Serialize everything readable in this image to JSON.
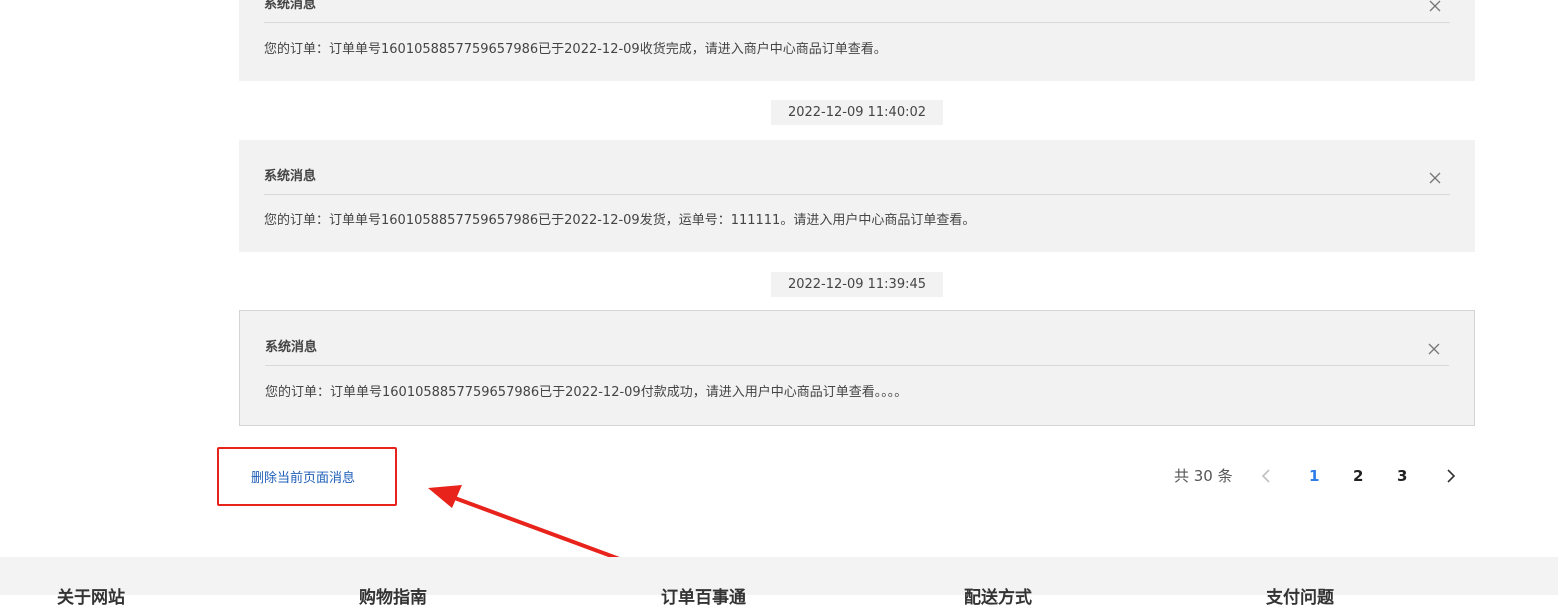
{
  "messages": [
    {
      "title": "系统消息",
      "body": "您的订单：订单单号1601058857759657986已于2022-12-09收货完成，请进入商户中心商品订单查看。"
    },
    {
      "time": "2022-12-09 11:40:02",
      "title": "系统消息",
      "body": "您的订单：订单单号1601058857759657986已于2022-12-09发货，运单号：111111。请进入用户中心商品订单查看。"
    },
    {
      "time": "2022-12-09 11:39:45",
      "title": "系统消息",
      "body": "您的订单：订单单号1601058857759657986已于2022-12-09付款成功，请进入用户中心商品订单查看。。。。"
    }
  ],
  "actions": {
    "delete_label": "删除当前页面消息"
  },
  "pagination": {
    "total": "共 30 条",
    "pages": [
      "1",
      "2",
      "3"
    ],
    "current": "1"
  },
  "footer": {
    "columns": [
      "关于网站",
      "购物指南",
      "订单百事通",
      "配送方式",
      "支付问题"
    ]
  },
  "colors": {
    "accent": "#2f7ee8",
    "link": "#1f5fb8",
    "annotation": "#e8231b",
    "card_bg": "#f2f2f2"
  },
  "icons": {
    "close": "close-icon",
    "prev": "chevron-left-icon",
    "next": "chevron-right-icon"
  }
}
